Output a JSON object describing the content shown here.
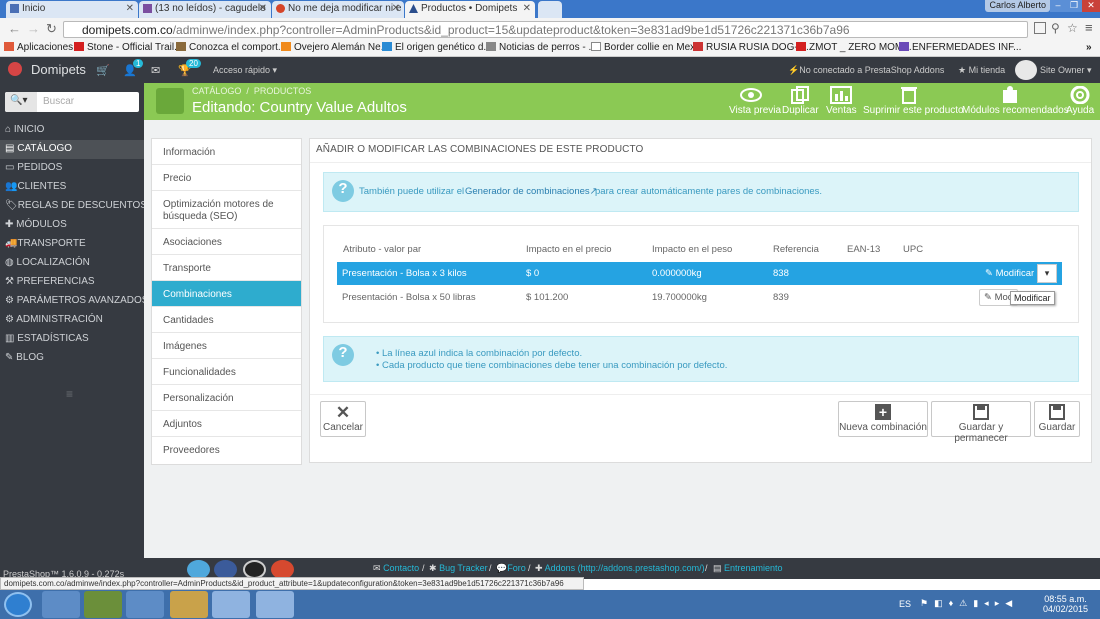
{
  "browser": {
    "tabs": [
      {
        "label": "Inicio",
        "active": false
      },
      {
        "label": "(13 no leídos) - cagudelo",
        "active": false
      },
      {
        "label": "No me deja modificar ni e",
        "active": false
      },
      {
        "label": "Productos • Domipets",
        "active": true
      }
    ],
    "user": "Carlos Alberto",
    "url_host": "domipets.com.co",
    "url_path": "/adminwe/index.php?controller=AdminProducts&id_product=15&updateproduct&token=3e831ad9be1d51726c221371c36b7a96",
    "bookmarks": [
      "Aplicaciones",
      "Stone - Official Trail...",
      "Conozca el comport...",
      "Ovejero Alemán Ne...",
      "El origen genético d...",
      "Noticias de perros - ...",
      "Border collie en Mex...",
      "RUSIA RUSIA DOG-r...",
      "ZMOT _ ZERO MOM...",
      "ENFERMEDADES INF..."
    ]
  },
  "header": {
    "shop_name": "Domipets",
    "cart_badge": "1",
    "trophy_badge": "20",
    "quick_access": "Acceso rápido",
    "addons_status": "No conectado a PrestaShop Addons",
    "my_shop": "Mi tienda",
    "owner": "Site Owner"
  },
  "sidebar": {
    "search_placeholder": "Buscar",
    "items": [
      {
        "label": "INICIO",
        "active": false
      },
      {
        "label": "CATÁLOGO",
        "active": true
      },
      {
        "label": "PEDIDOS",
        "active": false
      },
      {
        "label": "CLIENTES",
        "active": false
      },
      {
        "label": "REGLAS DE DESCUENTOS",
        "active": false
      },
      {
        "label": "MÓDULOS",
        "active": false
      },
      {
        "label": "TRANSPORTE",
        "active": false
      },
      {
        "label": "LOCALIZACIÓN",
        "active": false
      },
      {
        "label": "PREFERENCIAS",
        "active": false
      },
      {
        "label": "PARÁMETROS AVANZADOS",
        "active": false
      },
      {
        "label": "ADMINISTRACIÓN",
        "active": false
      },
      {
        "label": "ESTADÍSTICAS",
        "active": false
      },
      {
        "label": "BLOG",
        "active": false
      }
    ]
  },
  "toolbar": {
    "breadcrumb_1": "CATÁLOGO",
    "breadcrumb_2": "PRODUCTOS",
    "title": "Editando: Country Value Adultos",
    "buttons": [
      "Vista previa",
      "Duplicar",
      "Ventas",
      "Suprimir este producto",
      "Módulos recomendados",
      "Ayuda"
    ]
  },
  "product_tabs": [
    "Información",
    "Precio",
    "Optimización motores de búsqueda (SEO)",
    "Asociaciones",
    "Transporte",
    "Combinaciones",
    "Cantidades",
    "Imágenes",
    "Funcionalidades",
    "Personalización",
    "Adjuntos",
    "Proveedores"
  ],
  "panel": {
    "heading": "AÑADIR O MODIFICAR LAS COMBINACIONES DE ESTE PRODUCTO",
    "info_before": "También puede utilizar el",
    "info_link": "Generador de combinaciones",
    "info_after": "para crear automáticamente pares de combinaciones.",
    "table_headers": [
      "Atributo - valor par",
      "Impacto en el precio",
      "Impacto en el peso",
      "Referencia",
      "EAN-13",
      "UPC"
    ],
    "rows": [
      {
        "attr": "Presentación - Bolsa x 3 kilos",
        "price": "$ 0",
        "weight": "0.000000kg",
        "ref": "838",
        "ean": "",
        "upc": "",
        "action": "Modificar"
      },
      {
        "attr": "Presentación - Bolsa x 50 libras",
        "price": "$ 101.200",
        "weight": "19.700000kg",
        "ref": "839",
        "ean": "",
        "upc": "",
        "action": "Mod"
      }
    ],
    "tooltip": "Modificar",
    "notes": [
      "La línea azul indica la combinación por defecto.",
      "Cada producto que tiene combinaciones debe tener una combinación por defecto."
    ],
    "cancel": "Cancelar",
    "new_combination": "Nueva combinación",
    "save_stay": "Guardar y permanecer",
    "save": "Guardar"
  },
  "footer": {
    "version": "PrestaShop™ 1.6.0.9 - 0.272s",
    "contact": "Contacto",
    "bug_tracker": "Bug Tracker",
    "forum": "Foro",
    "addons": "Addons (http://addons.prestashop.com/)",
    "training": "Entrenamiento"
  },
  "status_url": "domipets.com.co/adminwe/index.php?controller=AdminProducts&id_product_attribute=1&updateconfiguration&token=3e831ad9be1d51726c221371c36b7a96",
  "taskbar": {
    "lang": "ES",
    "time": "08:55 a.m.",
    "date": "04/02/2015"
  },
  "colors": {
    "toolbar_green": "#8bc954",
    "active_blue": "#2eacce",
    "dark": "#363a41"
  }
}
